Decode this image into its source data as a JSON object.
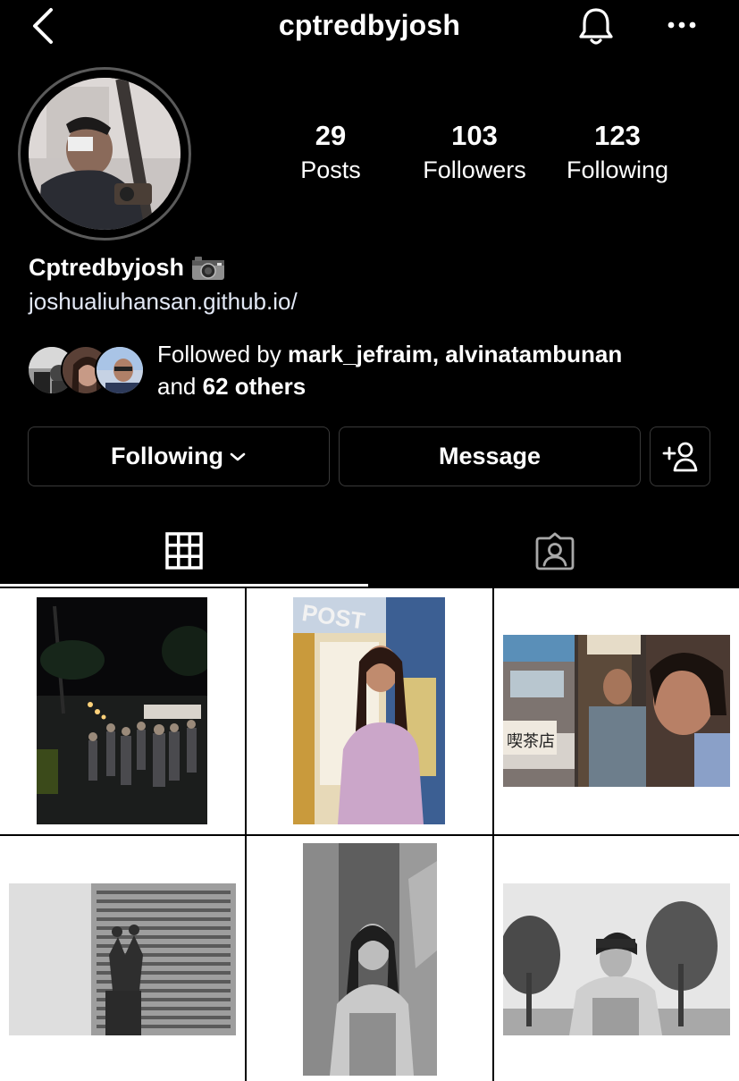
{
  "header": {
    "username": "cptredbyjosh",
    "icons": {
      "back": "chevron-left-icon",
      "notifications": "bell-icon",
      "more": "more-horizontal-icon"
    }
  },
  "stats": [
    {
      "value": "29",
      "label": "Posts"
    },
    {
      "value": "103",
      "label": "Followers"
    },
    {
      "value": "123",
      "label": "Following"
    }
  ],
  "profile": {
    "display_name": "Cptredbyjosh",
    "display_name_emoji": "camera-icon",
    "link": "joshualiuhansan.github.io/"
  },
  "followed_by": {
    "prefix": "Followed by ",
    "names": "mark_jefraim, alvinatambunan",
    "middle": "and ",
    "others": "62 others"
  },
  "actions": {
    "following_label": "Following",
    "message_label": "Message",
    "suggest_icon": "add-person-icon"
  },
  "tabs": [
    {
      "name": "posts-grid",
      "icon": "grid-icon",
      "active": true
    },
    {
      "name": "tagged",
      "icon": "tagged-person-icon",
      "active": false
    }
  ],
  "colors": {
    "background": "#000000",
    "text": "#ffffff",
    "link": "#e2e8f5",
    "border": "#3a3a3a",
    "grid_background": "#ffffff"
  }
}
